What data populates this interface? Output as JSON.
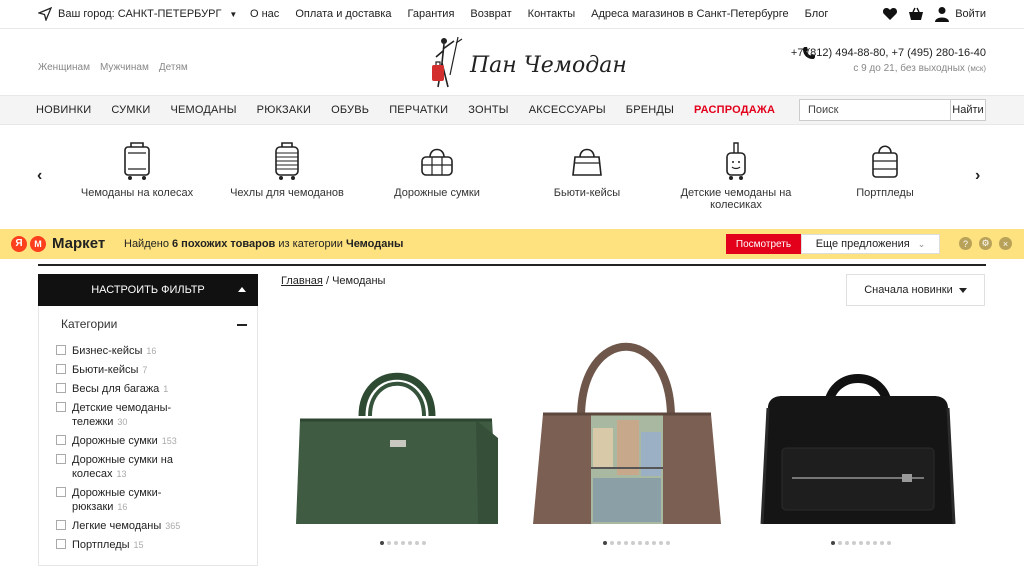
{
  "topbar": {
    "city_label": "Ваш город: САНКТ-ПЕТЕРБУРГ",
    "links": [
      "О нас",
      "Оплата и доставка",
      "Гарантия",
      "Возврат",
      "Контакты",
      "Адреса магазинов в Санкт-Петербурге",
      "Блог"
    ],
    "login": "Войти"
  },
  "header": {
    "gender": [
      "Женщинам",
      "Мужчинам",
      "Детям"
    ],
    "logo_text": "Пан Чемодан",
    "phones": "+7 (812) 494-88-80, +7 (495) 280-16-40",
    "hours": "с 9 до 21, без выходных",
    "hours_note": "(мск)"
  },
  "nav": {
    "items": [
      "НОВИНКИ",
      "СУМКИ",
      "ЧЕМОДАНЫ",
      "РЮКЗАКИ",
      "ОБУВЬ",
      "ПЕРЧАТКИ",
      "ЗОНТЫ",
      "АКСЕССУАРЫ",
      "БРЕНДЫ"
    ],
    "sale": "РАСПРОДАЖА",
    "sale_color": "#e3001b",
    "search_placeholder": "Поиск",
    "search_button": "Найти"
  },
  "categories": [
    {
      "label": "Чемоданы на колесах",
      "icon": "suitcase-icon"
    },
    {
      "label": "Чехлы для чемоданов",
      "icon": "suitcase-cover-icon"
    },
    {
      "label": "Дорожные сумки",
      "icon": "travel-bag-icon"
    },
    {
      "label": "Бьюти-кейсы",
      "icon": "beauty-case-icon"
    },
    {
      "label": "Детские чемоданы на колесиках",
      "icon": "kids-suitcase-icon"
    },
    {
      "label": "Портпледы",
      "icon": "garment-bag-icon"
    }
  ],
  "market": {
    "ya": "Я",
    "m": "М",
    "name": "Маркет",
    "found_prefix": "Найдено",
    "found_count": "6 похожих товаров",
    "found_middle": "из категории",
    "found_category": "Чемоданы",
    "view_button": "Посмотреть",
    "more_button": "Еще предложения",
    "bar_color": "#fee27f"
  },
  "filter": {
    "header": "НАСТРОИТЬ ФИЛЬТР",
    "section": "Категории",
    "items": [
      {
        "label": "Бизнес-кейсы",
        "count": "16"
      },
      {
        "label": "Бьюти-кейсы",
        "count": "7"
      },
      {
        "label": "Весы для багажа",
        "count": "1"
      },
      {
        "label": "Детские чемоданы-тележки",
        "count": "30"
      },
      {
        "label": "Дорожные сумки",
        "count": "153"
      },
      {
        "label": "Дорожные сумки на колесах",
        "count": "13"
      },
      {
        "label": "Дорожные сумки-рюкзаки",
        "count": "16"
      },
      {
        "label": "Легкие чемоданы",
        "count": "365"
      },
      {
        "label": "Портпледы",
        "count": "15"
      }
    ]
  },
  "breadcrumb": {
    "home": "Главная",
    "sep": "/",
    "current": "Чемоданы"
  },
  "sort": {
    "label": "Сначала новинки"
  },
  "products": [
    {
      "name": "green-travel-bag",
      "color": "#3f5c43"
    },
    {
      "name": "printed-travel-bag",
      "color": "#7a5f52"
    },
    {
      "name": "black-leather-travel-bag",
      "color": "#141414"
    }
  ]
}
